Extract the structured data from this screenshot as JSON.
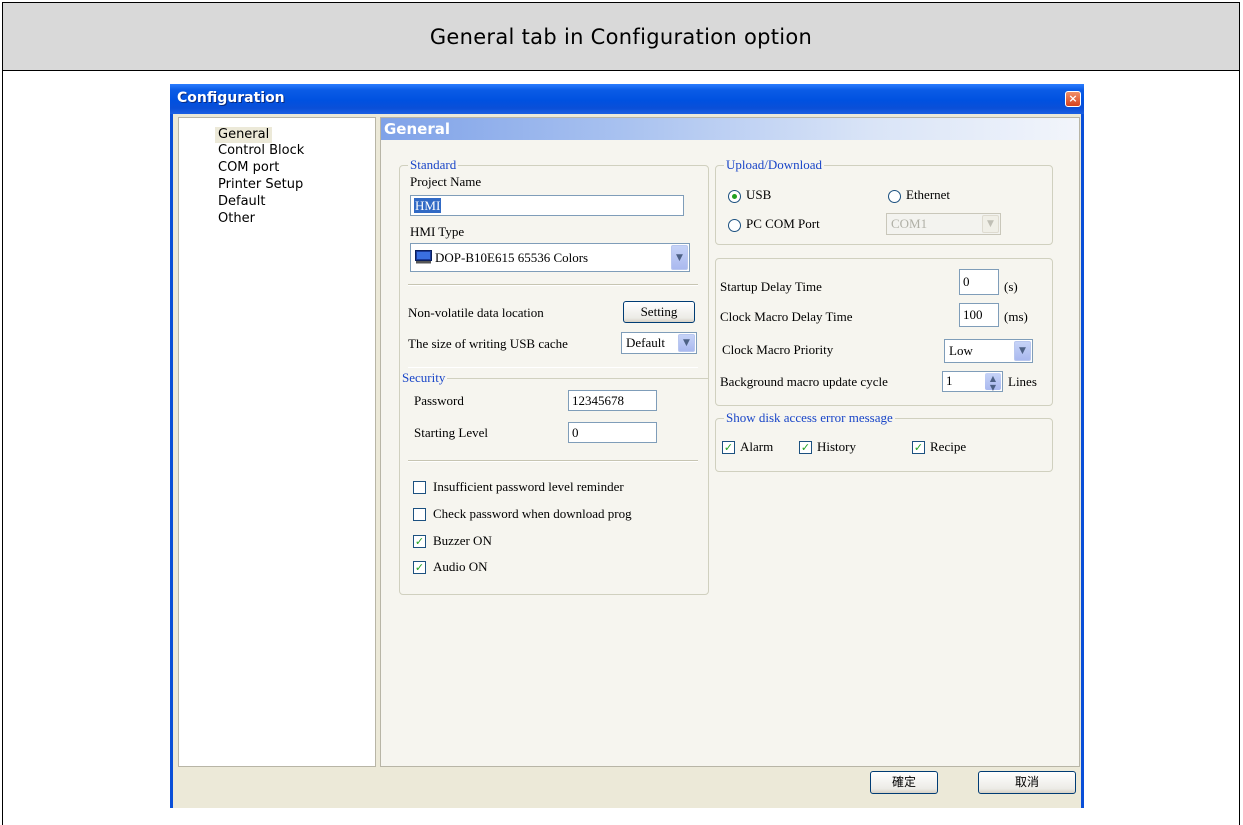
{
  "page_title": "General tab in Configuration option",
  "dialog": {
    "title": "Configuration",
    "close_symbol": "×",
    "sidebar_items": [
      "General",
      "Control Block",
      "COM port",
      "Printer Setup",
      "Default",
      "Other"
    ],
    "panel_title": "General",
    "standard": {
      "group_label": "Standard",
      "project_name_label": "Project Name",
      "project_name_value": "HMI",
      "hmi_type_label": "HMI Type",
      "hmi_type_value": "DOP-B10E615 65536 Colors",
      "nonvolatile_label": "Non-volatile data location",
      "setting_button": "Setting",
      "usb_cache_label": "The size of writing USB cache",
      "usb_cache_value": "Default"
    },
    "security": {
      "group_label": "Security",
      "password_label": "Password",
      "password_value": "12345678",
      "starting_level_label": "Starting Level",
      "starting_level_value": "0"
    },
    "options": [
      {
        "label": "Insufficient password level reminder",
        "checked": false
      },
      {
        "label": "Check password when download prog",
        "checked": false
      },
      {
        "label": "Buzzer ON",
        "checked": true
      },
      {
        "label": "Audio ON",
        "checked": true
      }
    ],
    "upload_download": {
      "group_label": "Upload/Download",
      "usb_label": "USB",
      "usb_selected": true,
      "ethernet_label": "Ethernet",
      "pc_com_label": "PC COM Port",
      "com_value": "COM1"
    },
    "timing": {
      "startup_delay_label": "Startup Delay Time",
      "startup_delay_value": "0",
      "startup_delay_unit": "(s)",
      "clock_macro_delay_label": "Clock Macro Delay Time",
      "clock_macro_delay_value": "100",
      "clock_macro_delay_unit": "(ms)",
      "clock_macro_priority_label": "Clock Macro Priority",
      "clock_macro_priority_value": "Low",
      "background_macro_label": "Background macro update cycle",
      "background_macro_value": "1",
      "background_macro_unit": "Lines"
    },
    "disk_error": {
      "group_label": "Show disk access error message",
      "alarm_label": "Alarm",
      "history_label": "History",
      "recipe_label": "Recipe"
    },
    "ok_button": "確定",
    "cancel_button": "取消"
  }
}
